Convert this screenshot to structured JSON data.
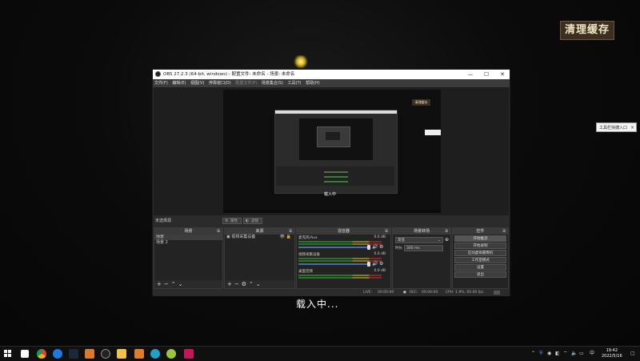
{
  "wallpaper": {
    "logo_text": "清理缓存",
    "overlay_text": "载入中..."
  },
  "tooltip": {
    "text": "工具栏快捷入口",
    "close": "×"
  },
  "window": {
    "title": "OBS 27.2.3 (64-bit, windows) - 配置文件: 未命名 - 场景: 未命名",
    "min": "—",
    "max": "☐",
    "close": "✕",
    "menu": [
      {
        "label": "文件(F)"
      },
      {
        "label": "编辑(E)"
      },
      {
        "label": "视图(V)"
      },
      {
        "label": "停靠窗口(D)"
      },
      {
        "label": "配置文件(P)"
      },
      {
        "label": "场景集合(S)"
      },
      {
        "label": "工具(T)"
      },
      {
        "label": "帮助(H)"
      }
    ]
  },
  "preview": {
    "logo_text": "清理缓存",
    "loading_text": "载入中"
  },
  "scene_info": {
    "label": "未选择源",
    "props_button": "属性",
    "filters_button": "滤镜"
  },
  "scenes": {
    "title": "场景",
    "items": [
      "场景",
      "场景 2"
    ]
  },
  "sources": {
    "title": "来源",
    "items": [
      "视频采集设备"
    ]
  },
  "mixer": {
    "title": "混音器",
    "channels": [
      {
        "name": "麦克风/Aux",
        "db": "0.0 dB"
      },
      {
        "name": "视频采集设备",
        "db": "0.0 dB"
      },
      {
        "name": "桌面音频",
        "db": "0.0 dB"
      }
    ]
  },
  "transitions": {
    "title": "场景转场",
    "type": "渐变",
    "duration_label": "时长",
    "duration_value": "300 ms"
  },
  "controls": {
    "title": "控件",
    "buttons": [
      "开始推流",
      "开始录制",
      "启动虚拟摄像机",
      "工作室模式",
      "设置",
      "退出"
    ]
  },
  "status": {
    "live_label": "LIVE:",
    "live_time": "00:00:00",
    "rec_label": "REC:",
    "rec_time": "00:00:00",
    "cpu": "CPU: 1.9%, 60.00 fps"
  },
  "taskbar": {
    "time": "19:42",
    "date": "2022/5/16",
    "lang": "中"
  },
  "colors": {
    "obs_bg": "#2b2b2b",
    "dock_bg": "#232323",
    "accent_slider": "#4a6ab0",
    "meter_green": "#2f6f2f"
  }
}
